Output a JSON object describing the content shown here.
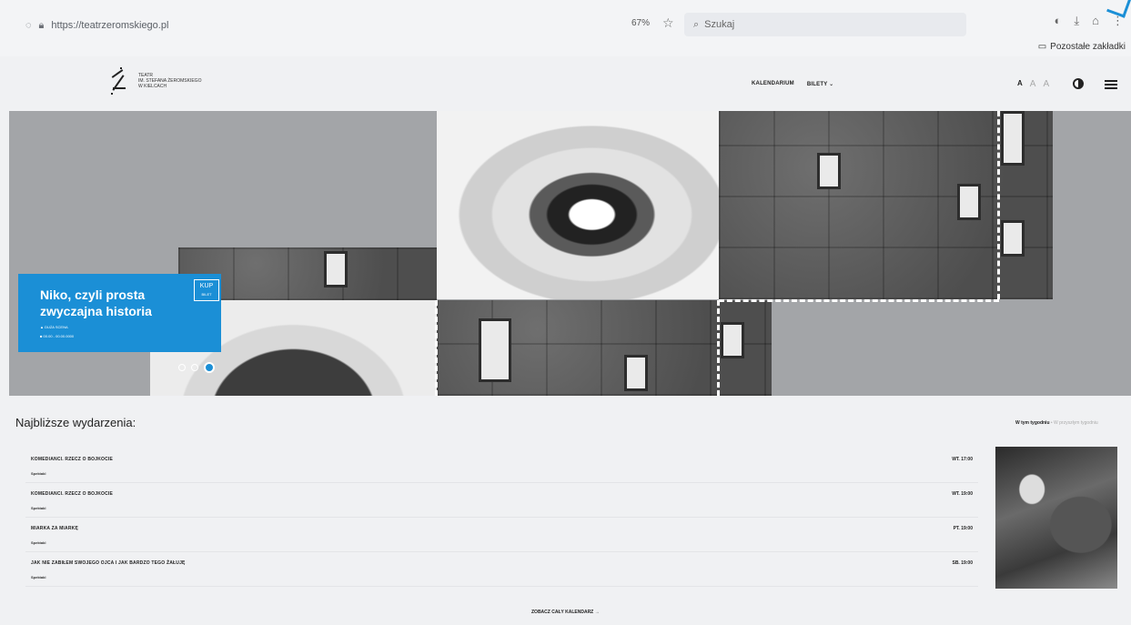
{
  "browser": {
    "url": "https://teatrzeromskiego.pl",
    "zoom": "67%",
    "search_placeholder": "Szukaj",
    "bookmarks_label": "Pozostałe zakładki"
  },
  "header": {
    "logo_lines": [
      "Teatr",
      "im. Stefana Żeromskiego",
      "w Kielcach"
    ],
    "nav": [
      "KALENDARIUM",
      "BILETY ⌄"
    ],
    "font_sizes": [
      "A",
      "A",
      "A"
    ]
  },
  "hero": {
    "event_title": "Niko, czyli prosta zwyczajna historia",
    "event_meta": [
      "DUŻA SCENA",
      "00.00 - 00.00.0000"
    ],
    "buy_label": "KUP",
    "buy_sub": "BILET",
    "slides": 3,
    "active_slide": 3
  },
  "events": {
    "title": "Najbliższe wydarzenia:",
    "filter_active": "W tym tygodniu",
    "filter_inactive": "W przyszłym tygodniu",
    "rows": [
      {
        "title": "KOMEDIANCI. RZECZ O BOJKOCIE",
        "sub": "Spektakl",
        "time": "WT. 17:00"
      },
      {
        "title": "KOMEDIANCI. RZECZ O BOJKOCIE",
        "sub": "Spektakl",
        "time": "WT. 19:00"
      },
      {
        "title": "MIARKA ZA MIARKĘ",
        "sub": "Spektakl",
        "time": "PT. 19:00"
      },
      {
        "title": "JAK NIE ZABIŁEM SWOJEGO OJCA I JAK BARDZO TEGO ŻAŁUJĘ",
        "sub": "Spektakl",
        "time": "SB. 19:00"
      }
    ],
    "calendar_link": "ZOBACZ CAŁY KALENDARZ →"
  }
}
